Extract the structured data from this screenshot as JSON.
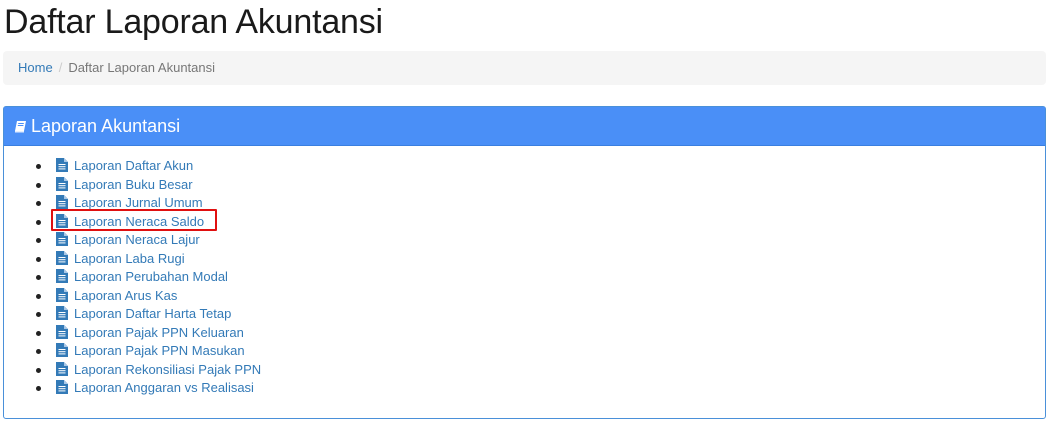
{
  "page": {
    "title": "Daftar Laporan Akuntansi"
  },
  "breadcrumb": {
    "home": "Home",
    "separator": "/",
    "current": "Daftar Laporan Akuntansi"
  },
  "panel": {
    "title": "Laporan Akuntansi",
    "icon": "book-icon",
    "items": [
      {
        "label": "Laporan Daftar Akun",
        "icon": "file-text-icon"
      },
      {
        "label": "Laporan Buku Besar",
        "icon": "file-text-icon"
      },
      {
        "label": "Laporan Jurnal Umum",
        "icon": "file-text-icon"
      },
      {
        "label": "Laporan Neraca Saldo",
        "icon": "file-text-icon",
        "highlighted": true
      },
      {
        "label": "Laporan Neraca Lajur",
        "icon": "file-text-icon"
      },
      {
        "label": "Laporan Laba Rugi",
        "icon": "file-text-icon"
      },
      {
        "label": "Laporan Perubahan Modal",
        "icon": "file-text-icon"
      },
      {
        "label": "Laporan Arus Kas",
        "icon": "file-text-icon"
      },
      {
        "label": "Laporan Daftar Harta Tetap",
        "icon": "file-text-icon"
      },
      {
        "label": "Laporan Pajak PPN Keluaran",
        "icon": "file-text-icon"
      },
      {
        "label": "Laporan Pajak PPN Masukan",
        "icon": "file-text-icon"
      },
      {
        "label": "Laporan Rekonsiliasi Pajak PPN",
        "icon": "file-text-icon"
      },
      {
        "label": "Laporan Anggaran vs Realisasi",
        "icon": "file-text-icon"
      }
    ]
  },
  "colors": {
    "panel_header": "#4a8ff7",
    "link": "#337ab7",
    "highlight": "#e01010"
  }
}
